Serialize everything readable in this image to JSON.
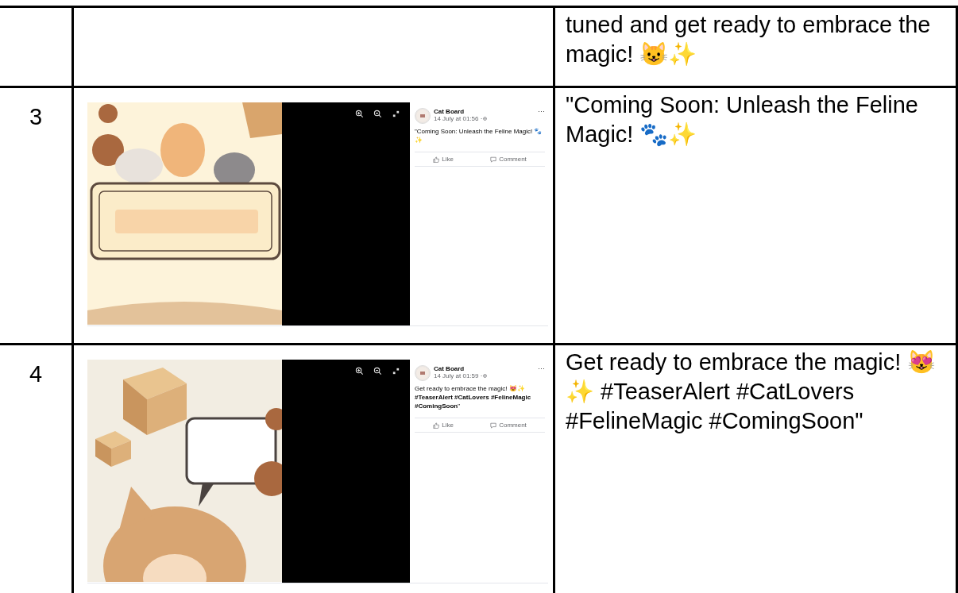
{
  "rows": [
    {
      "caption": "tuned and get ready to embrace the magic! 😺✨"
    },
    {
      "number": "3",
      "screenshot": {
        "page_name": "Cat Board",
        "timestamp": "14 July at 01:56 ·",
        "more": "···",
        "text": "\"Coming Soon: Unleash the Feline Magic! 🐾✨",
        "actions": [
          "Like",
          "Comment"
        ]
      },
      "caption": "\"Coming Soon: Unleash the Feline Magic! 🐾✨"
    },
    {
      "number": "4",
      "screenshot": {
        "page_name": "Cat Board",
        "timestamp": "14 July at 01:59 ·",
        "more": "···",
        "text": "Get ready to embrace the magic! 😻✨ **#TeaserAlert #CatLovers #FelineMagic #ComingSoon**\"",
        "actions": [
          "Like",
          "Comment"
        ]
      },
      "caption": "Get ready to embrace the magic! 😻✨ #TeaserAlert #CatLovers #FelineMagic #ComingSoon\""
    }
  ]
}
